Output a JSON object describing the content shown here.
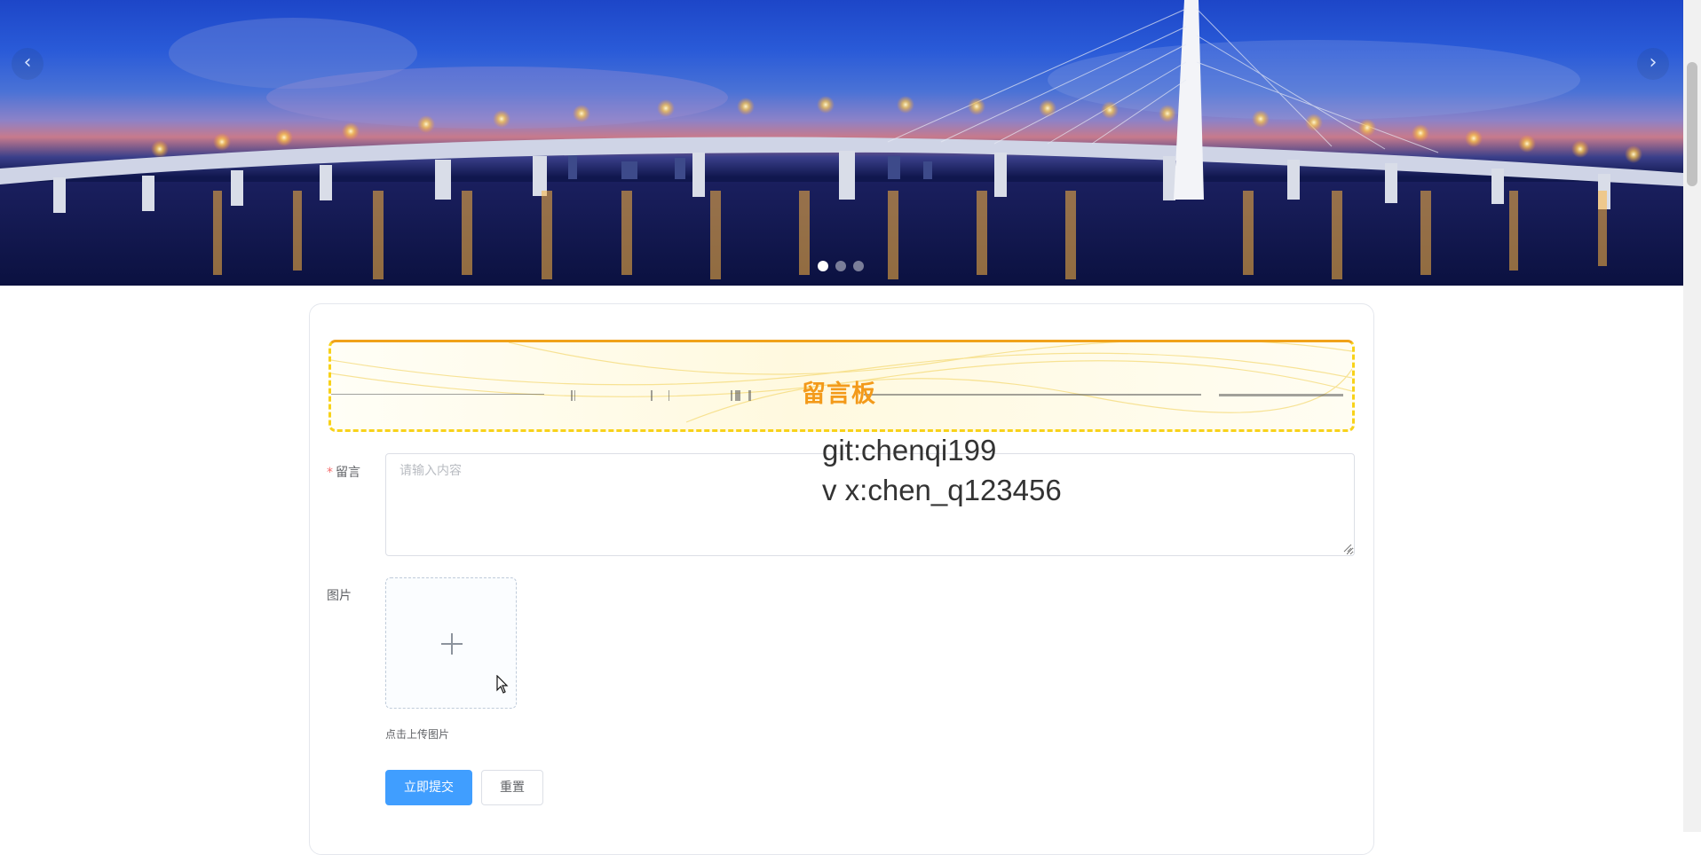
{
  "carousel": {
    "prev_arrow": "‹",
    "next_arrow": "›",
    "slide_count": 3,
    "active_slide": 1
  },
  "board": {
    "title": "留言板"
  },
  "watermark": {
    "line1": "git:chenqi199",
    "line2": "v x:chen_q123456"
  },
  "form": {
    "message_label": "留言",
    "message_required_mark": "*",
    "message_placeholder": "请输入内容",
    "image_label": "图片",
    "upload_tip": "点击上传图片",
    "submit_label": "立即提交",
    "reset_label": "重置"
  },
  "colors": {
    "primary": "#409eff",
    "board_title": "#f39a1a",
    "required": "#f56c6c"
  }
}
